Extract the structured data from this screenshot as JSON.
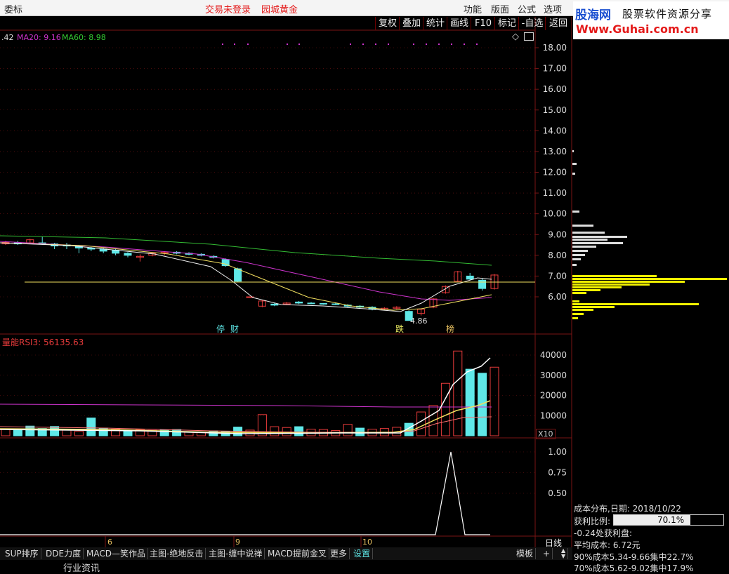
{
  "menu": {
    "left": "委标",
    "status_login": "交易未登录",
    "stock_name": "园城黄金",
    "items": [
      "功能",
      "版面",
      "公式",
      "选项"
    ]
  },
  "toolbar": [
    "复权",
    "叠加",
    "统计",
    "画线",
    "F10",
    "标记",
    "-自选",
    "返回"
  ],
  "logo": {
    "line1a": "股海网",
    "line1b": "股票软件资源分享",
    "line2": "Www.Guhai.com.cn"
  },
  "indicators": {
    "ma_prefix": ".42",
    "ma20": "MA20: 9.16",
    "ma60": "MA60: 8.98",
    "vol_title": "量能RSI3: 56135.63",
    "x10": "X10"
  },
  "price_axis": [
    "18.00",
    "17.00",
    "16.00",
    "15.00",
    "14.00",
    "13.00",
    "12.00",
    "11.00",
    "10.00",
    "9.00",
    "8.00",
    "7.00",
    "6.00"
  ],
  "vol_axis": [
    "40000",
    "30000",
    "20000",
    "10000"
  ],
  "ind_axis": [
    "1.00",
    "0.75",
    "0.50"
  ],
  "markers": {
    "ting": "停",
    "cai": "财",
    "die": "跌",
    "bang": "榜",
    "low_value": "4.86"
  },
  "dates": {
    "d6": "6",
    "d9": "9",
    "d10": "10",
    "period": "日线"
  },
  "tabs": [
    "SUP排序",
    "DDE力度",
    "MACD—笑作品",
    "主图-绝地反击",
    "主图-缠中说禅",
    "MACD提前金叉",
    "更多",
    "设置"
  ],
  "tab_right": {
    "template": "模板",
    "plus": "+",
    "up": "▲",
    "down": "▼"
  },
  "news": "行业资讯",
  "cost": {
    "title": "成本分布,日期: 2018/10/22",
    "profit_label": "获利比例:",
    "profit_value": "70.1%",
    "profit_ratio": 0.701,
    "profit_zone": "-0.24处获利盘:",
    "avg_cost": "平均成本: 6.72元",
    "c90": "90%成本5.34-9.66集中22.7%",
    "c70": "70%成本5.62-9.02集中17.9%"
  },
  "colors": {
    "ma_white": "#f0f0f0",
    "ma_yellow": "#f2e060",
    "ma_magenta": "#cc33cc",
    "ma_green": "#33bb33",
    "up": "#e83b3b",
    "down": "#5fe8e8",
    "chip_yellow": "#f0f000",
    "grid": "#7a1414"
  }
}
